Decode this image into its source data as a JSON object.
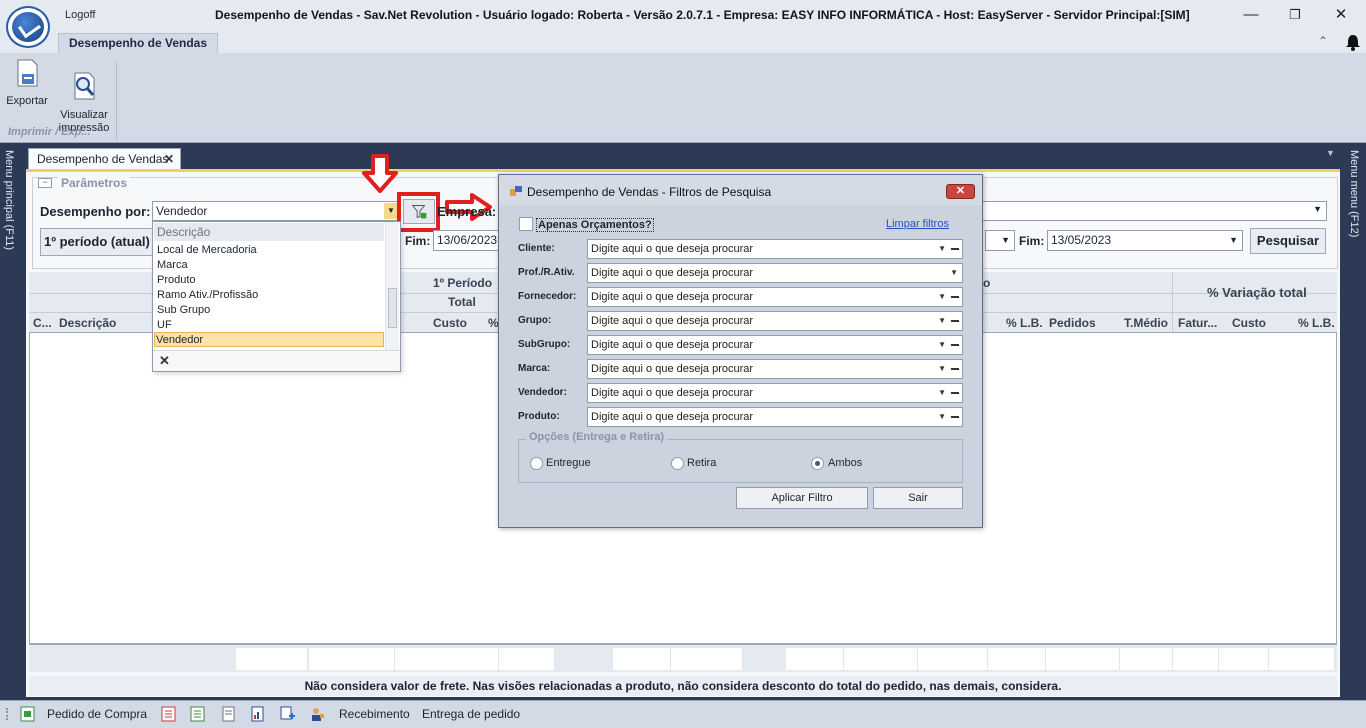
{
  "window": {
    "title": "Desempenho de Vendas - Sav.Net Revolution - Usuário logado: Roberta - Versão 2.0.7.1 - Empresa: EASY INFO INFORMÁTICA - Host: EasyServer - Servidor Principal:[SIM]",
    "logoff": "Logoff"
  },
  "ribbon": {
    "tab": "Desempenho de Vendas",
    "buttons": [
      {
        "label": "Exportar",
        "icon": "save-disk-icon"
      },
      {
        "label": "Visualizar\nimpressão",
        "icon": "print-preview-icon"
      }
    ],
    "group_label": "Imprimir / Exp..."
  },
  "side": {
    "left_menu": "Menu principal (F11)",
    "right_menu": "Menu menu (F12)"
  },
  "doc_tab": "Desempenho de Vendas",
  "params": {
    "section_label": "Parâmetros",
    "toggle": "−",
    "desempenho_label": "Desempenho por:",
    "desempenho_value": "Vendedor",
    "empresa_label": "Empresa:",
    "periodo1": "1º período (atual)",
    "fim_label": "Fim:",
    "fim1": "13/06/2023",
    "fim2": "13/05/2023",
    "pesquisar": "Pesquisar"
  },
  "dropdown": {
    "header": "Descrição",
    "items": [
      "Local de Mercadoria",
      "Marca",
      "Produto",
      "Ramo Ativ./Profissão",
      "Sub Grupo",
      "UF",
      "Vendedor"
    ],
    "selected": "Vendedor",
    "clear": "✕"
  },
  "grid": {
    "group_1": "1º Período",
    "group_total": "Total",
    "group_2_fragment": "o",
    "variacao": "% Variação total",
    "columns": [
      "C...",
      "Descrição",
      "Custo",
      "%",
      "% L.B.",
      "Pedidos",
      "T.Médio",
      "Fatur...",
      "Custo",
      "% L.B."
    ]
  },
  "note": "Não considera valor de frete. Nas visões relacionadas a produto, não considera desconto do total do pedido, nas demais, considera.",
  "modal": {
    "title": "Desempenho de Vendas - Filtros de Pesquisa",
    "close": "✕",
    "apenas": "Apenas Orçamentos?",
    "limpar": "Limpar filtros",
    "fields": [
      {
        "label": "Cliente:",
        "placeholder": "Digite aqui o que deseja procurar"
      },
      {
        "label": "Prof./R.Ativ.",
        "placeholder": "Digite aqui o que deseja procurar"
      },
      {
        "label": "Fornecedor:",
        "placeholder": "Digite aqui o que deseja procurar"
      },
      {
        "label": "Grupo:",
        "placeholder": "Digite aqui o que deseja procurar"
      },
      {
        "label": "SubGrupo:",
        "placeholder": "Digite aqui o que deseja procurar"
      },
      {
        "label": "Marca:",
        "placeholder": "Digite aqui o que deseja procurar"
      },
      {
        "label": "Vendedor:",
        "placeholder": "Digite aqui o que deseja procurar"
      },
      {
        "label": "Produto:",
        "placeholder": "Digite aqui o que deseja procurar"
      }
    ],
    "opcoes_label": "Opções (Entrega e Retira)",
    "radios": [
      {
        "label": "Entregue",
        "checked": false
      },
      {
        "label": "Retira",
        "checked": false
      },
      {
        "label": "Ambos",
        "checked": true
      }
    ],
    "apply": "Aplicar Filtro",
    "exit": "Sair"
  },
  "statusbar": {
    "items": [
      {
        "label": "Pedido de Compra",
        "icon": "purchase-order-icon"
      },
      {
        "label": "",
        "icon": "report-red-icon"
      },
      {
        "label": "",
        "icon": "report-green-icon"
      },
      {
        "label": "",
        "icon": "document-icon"
      },
      {
        "label": "",
        "icon": "chart-doc-icon"
      },
      {
        "label": "",
        "icon": "add-user-icon"
      },
      {
        "label": "Recebimento",
        "icon": "receiving-icon"
      },
      {
        "label": "Entrega de pedido",
        "icon": ""
      }
    ]
  },
  "colors": {
    "accent_yellow": "#f0cf68",
    "highlight_red": "#e01f1f",
    "link_blue": "#2a4fbf"
  }
}
